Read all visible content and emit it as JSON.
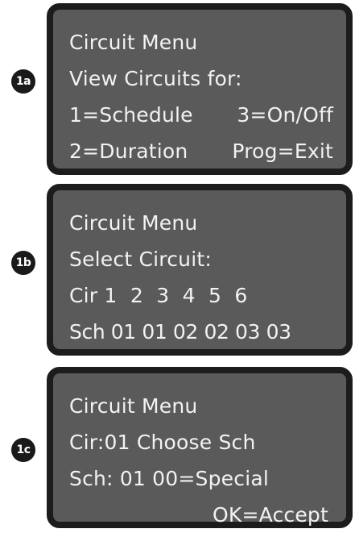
{
  "panels": [
    {
      "badge": "1a",
      "lines": {
        "l1": "Circuit Menu",
        "l2": "View Circuits for:",
        "l3_left": "1=Schedule",
        "l3_right": "3=On/Off",
        "l4_left": "2=Duration",
        "l4_right": "Prog=Exit"
      }
    },
    {
      "badge": "1b",
      "lines": {
        "l1": "Circuit Menu",
        "l2": "Select Circuit:",
        "l3": "Cir 1  2  3  4  5  6",
        "l4": "Sch 01 01 02 02 03 03"
      }
    },
    {
      "badge": "1c",
      "lines": {
        "l1": "Circuit Menu",
        "l2": "Cir:01 Choose Sch",
        "l3": "Sch: 01 00=Special",
        "l4": "OK=Accept"
      }
    }
  ],
  "colors": {
    "screen_bg": "#5a5a5a",
    "bezel": "#1c1c1c",
    "text": "#f2f2f2",
    "badge_bg": "#1a1a1a"
  }
}
